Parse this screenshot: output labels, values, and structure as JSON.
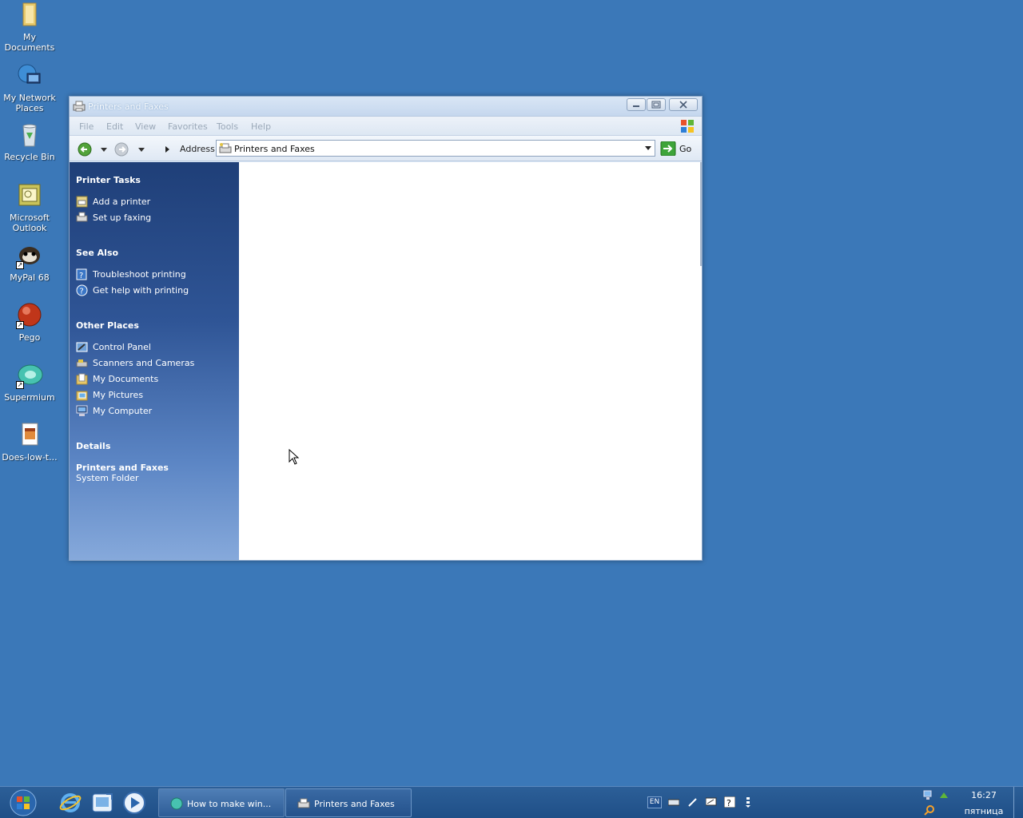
{
  "desktop": {
    "icons": [
      {
        "label": "My Documents",
        "icon": "folder-documents-icon"
      },
      {
        "label": "My Network Places",
        "icon": "network-places-icon"
      },
      {
        "label": "Recycle Bin",
        "icon": "recycle-bin-icon"
      },
      {
        "label": "Microsoft Outlook",
        "icon": "outlook-icon"
      },
      {
        "label": "MyPal 68",
        "icon": "mypal-icon"
      },
      {
        "label": "Pego",
        "icon": "pego-icon"
      },
      {
        "label": "Supermium",
        "icon": "supermium-icon"
      },
      {
        "label": "Does-low-t...",
        "icon": "document-file-icon"
      }
    ],
    "background_color": "#3b78b8"
  },
  "window": {
    "title": "Printers and Faxes",
    "menu": [
      "File",
      "Edit",
      "View",
      "Favorites",
      "Tools",
      "Help"
    ],
    "address_label": "Address",
    "address_value": "Printers and Faxes",
    "go_label": "Go",
    "taskpane": {
      "sections": [
        {
          "title": "Printer Tasks",
          "links": [
            {
              "label": "Add a printer",
              "icon": "add-printer-icon"
            },
            {
              "label": "Set up faxing",
              "icon": "fax-icon"
            }
          ]
        },
        {
          "title": "See Also",
          "links": [
            {
              "label": "Troubleshoot printing",
              "icon": "help-book-icon"
            },
            {
              "label": "Get help with printing",
              "icon": "help-circle-icon"
            }
          ]
        },
        {
          "title": "Other Places",
          "links": [
            {
              "label": "Control Panel",
              "icon": "control-panel-icon"
            },
            {
              "label": "Scanners and Cameras",
              "icon": "scanner-icon"
            },
            {
              "label": "My Documents",
              "icon": "documents-folder-icon"
            },
            {
              "label": "My Pictures",
              "icon": "pictures-folder-icon"
            },
            {
              "label": "My Computer",
              "icon": "computer-icon"
            }
          ]
        }
      ],
      "details": {
        "title": "Details",
        "name": "Printers and Faxes",
        "type": "System Folder"
      }
    }
  },
  "taskbar": {
    "tasks": [
      {
        "label": "How to make win...",
        "icon": "browser-icon"
      },
      {
        "label": "Printers and Faxes",
        "icon": "printer-icon"
      }
    ],
    "language": "EN",
    "clock_time": "16:27",
    "clock_day": "пятница"
  }
}
